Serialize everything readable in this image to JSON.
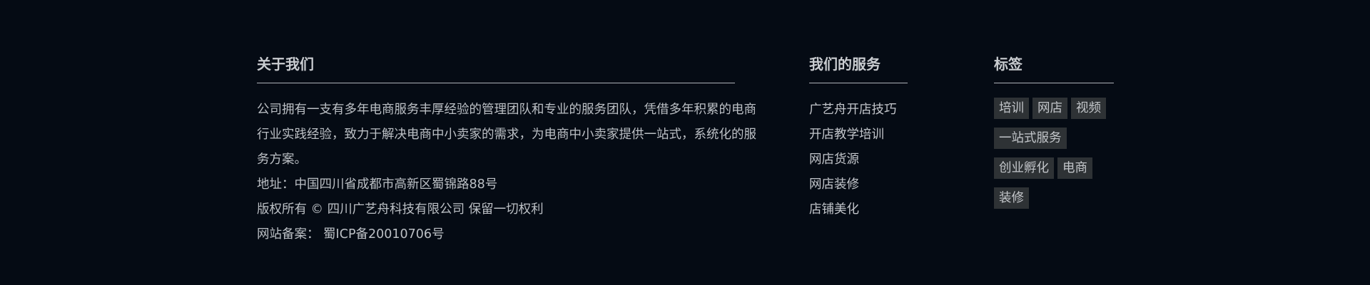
{
  "about": {
    "title": "关于我们",
    "description": "公司拥有一支有多年电商服务丰厚经验的管理团队和专业的服务团队，凭借多年积累的电商行业实践经验，致力于解决电商中小卖家的需求，为电商中小卖家提供一站式，系统化的服务方案。",
    "address": "地址：中国四川省成都市高新区蜀锦路88号",
    "copyright": "版权所有 © 四川广艺舟科技有限公司 保留一切权利",
    "icp": "网站备案： 蜀ICP备20010706号"
  },
  "services": {
    "title": "我们的服务",
    "items": [
      {
        "label": "广艺舟开店技巧"
      },
      {
        "label": "开店教学培训"
      },
      {
        "label": "网店货源"
      },
      {
        "label": "网店装修"
      },
      {
        "label": "店铺美化"
      }
    ]
  },
  "tags": {
    "title": "标签",
    "items": [
      {
        "label": "培训"
      },
      {
        "label": "网店"
      },
      {
        "label": "视频"
      },
      {
        "label": "一站式服务"
      },
      {
        "label": "创业孵化"
      },
      {
        "label": "电商"
      },
      {
        "label": "装修"
      }
    ]
  },
  "colors": {
    "background": "#050b14",
    "text": "#bcc0c5",
    "tag_background": "#2e3235",
    "rule": "#aeb3b8"
  }
}
